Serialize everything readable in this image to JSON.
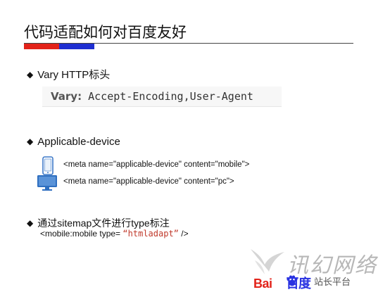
{
  "slide": {
    "title": "代码适配如何对百度友好",
    "accent_colors": {
      "red": "#e2231a",
      "blue": "#1f2fd1"
    }
  },
  "vary": {
    "bullet": "Vary HTTP标头",
    "code_key": "Vary:",
    "code_value": "Accept-Encoding,User-Agent"
  },
  "applicable": {
    "bullet": "Applicable-device",
    "mobile_meta": "<meta name=\"applicable-device\" content=\"mobile\">",
    "pc_meta": "<meta name=\"applicable-device\" content=\"pc\">",
    "icons": [
      "phone-icon",
      "monitor-icon"
    ]
  },
  "sitemap": {
    "bullet": "通过sitemap文件进行type标注",
    "code_prefix": "<mobile:mobile type=",
    "code_value": "“htmladapt”",
    "code_suffix": " />"
  },
  "watermark": {
    "brand_title": "讯幻网络",
    "baidu_red": "Bai",
    "baidu_blue": "百度",
    "sub": "站长平台"
  }
}
